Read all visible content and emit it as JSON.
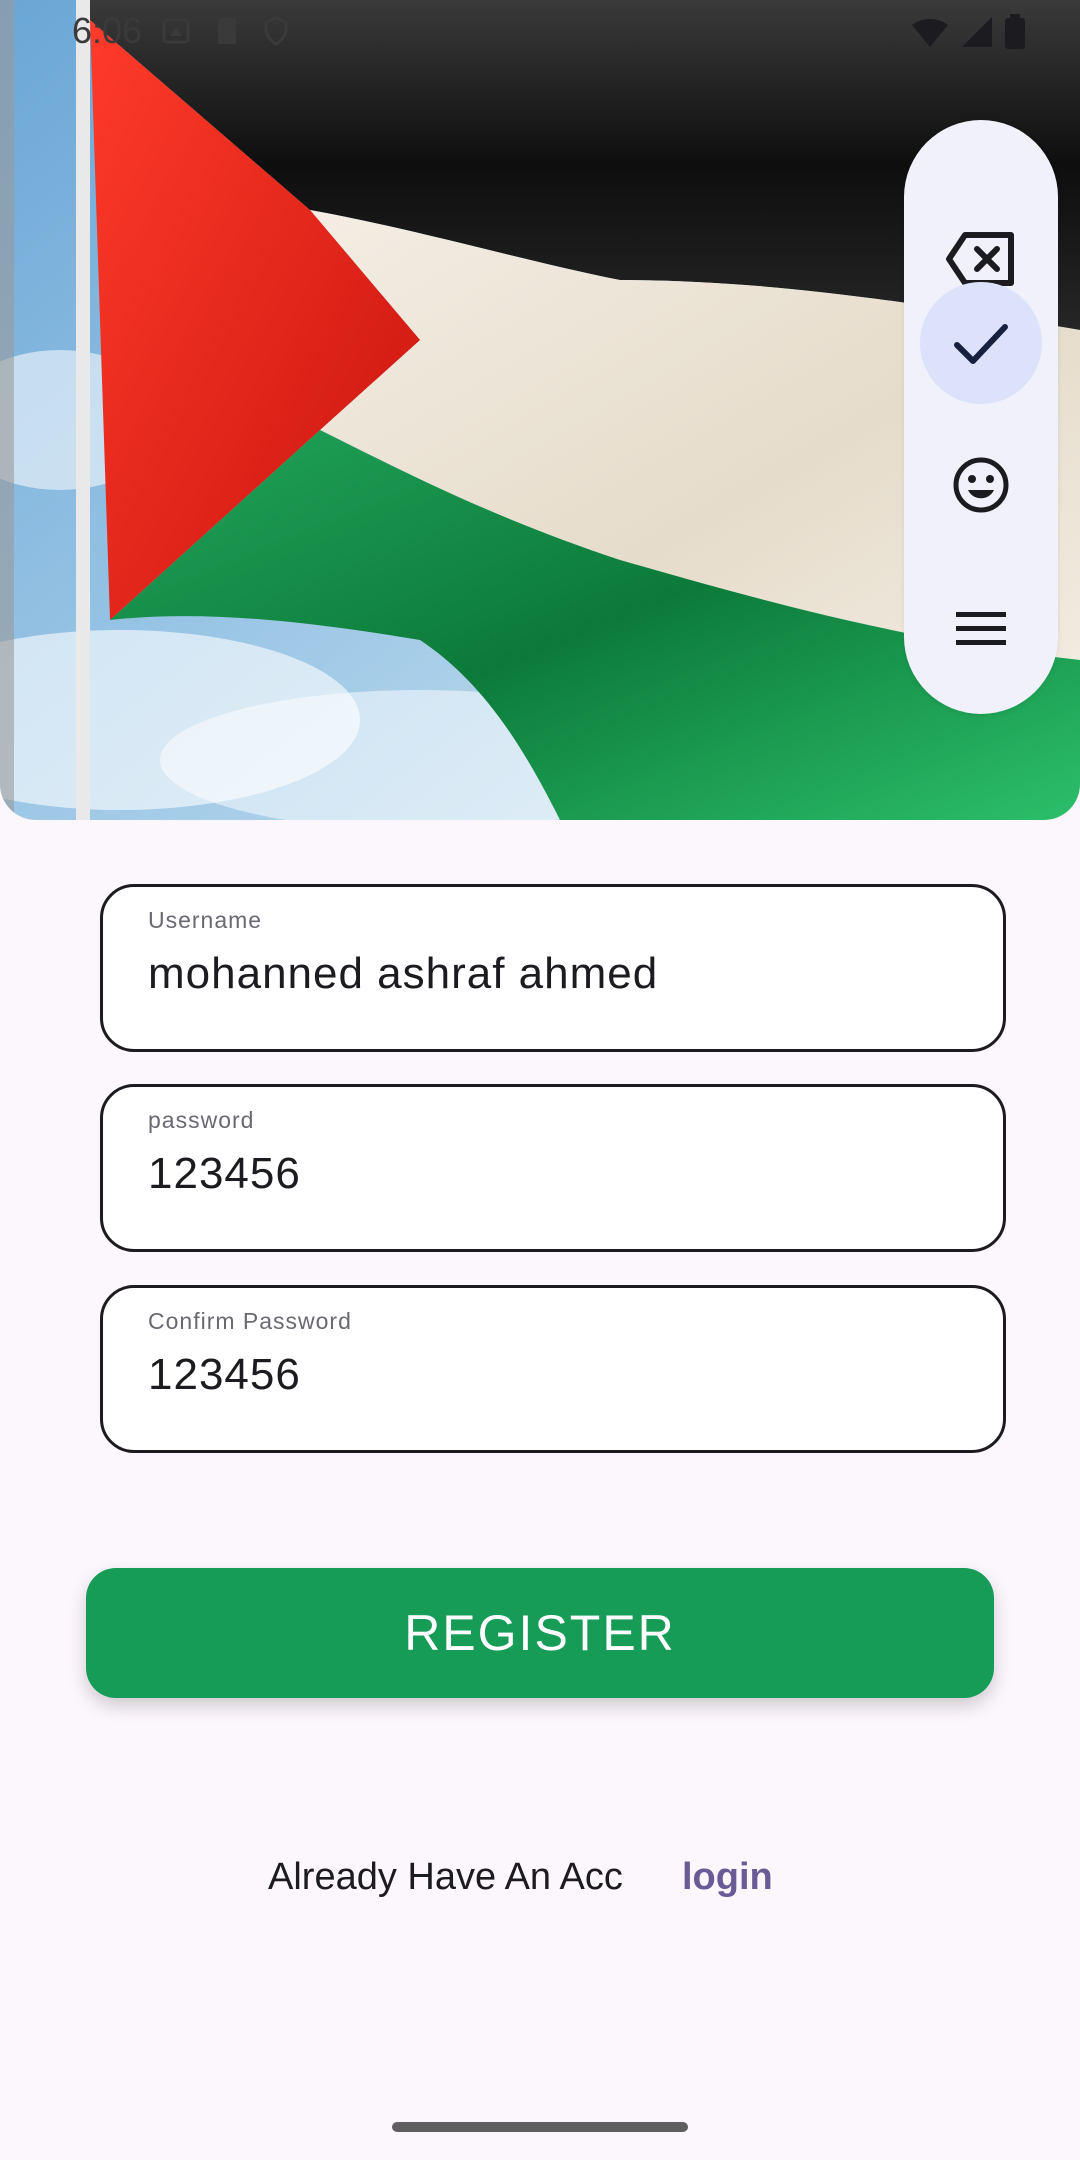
{
  "status_bar": {
    "time": "6:06"
  },
  "toolbar": {
    "items": [
      {
        "icon": "backspace-icon"
      },
      {
        "icon": "check-icon",
        "active": true
      },
      {
        "icon": "emoji-icon"
      },
      {
        "icon": "menu-icon"
      }
    ]
  },
  "form": {
    "username": {
      "label": "Username",
      "value": "mohanned ashraf ahmed"
    },
    "password": {
      "label": "password",
      "value": "123456"
    },
    "confirm_password": {
      "label": "Confirm Password",
      "value": "123456"
    }
  },
  "register_button": {
    "label": "REGISTER"
  },
  "footer": {
    "text": "Already Have An Acc",
    "link": "login"
  },
  "colors": {
    "primary_button": "#179c57",
    "link": "#6a5a96",
    "background": "#fcf6fd",
    "toolbar_active": "#dde2fb"
  }
}
